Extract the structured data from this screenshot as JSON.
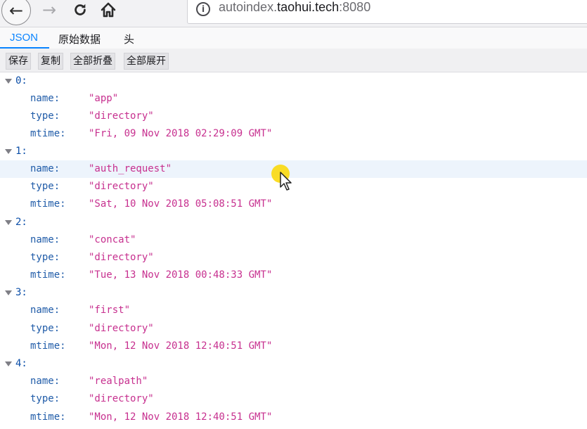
{
  "browser": {
    "url_prefix": "autoindex.",
    "url_domain": "taohui.tech",
    "url_suffix": ":8080",
    "back_icon": "←",
    "forward_icon": "→",
    "reload_icon": "↻",
    "info_icon": "i"
  },
  "tabs": {
    "json": "JSON",
    "raw": "原始数据",
    "headers": "头"
  },
  "actions": {
    "save": "保存",
    "copy": "复制",
    "collapse_all": "全部折叠",
    "expand_all": "全部展开"
  },
  "labels": {
    "name": "name:",
    "type": "type:",
    "mtime": "mtime:"
  },
  "entries": [
    {
      "index": "0:",
      "name": "\"app\"",
      "type": "\"directory\"",
      "mtime": "\"Fri, 09 Nov 2018 02:29:09 GMT\""
    },
    {
      "index": "1:",
      "name": "\"auth_request\"",
      "type": "\"directory\"",
      "mtime": "\"Sat, 10 Nov 2018 05:08:51 GMT\""
    },
    {
      "index": "2:",
      "name": "\"concat\"",
      "type": "\"directory\"",
      "mtime": "\"Tue, 13 Nov 2018 00:48:33 GMT\""
    },
    {
      "index": "3:",
      "name": "\"first\"",
      "type": "\"directory\"",
      "mtime": "\"Mon, 12 Nov 2018 12:40:51 GMT\""
    },
    {
      "index": "4:",
      "name": "\"realpath\"",
      "type": "\"directory\"",
      "mtime": "\"Mon, 12 Nov 2018 12:40:51 GMT\""
    }
  ],
  "colors": {
    "accent": "#0a84ff",
    "key": "#1f5ba8",
    "string": "#c7308f"
  }
}
